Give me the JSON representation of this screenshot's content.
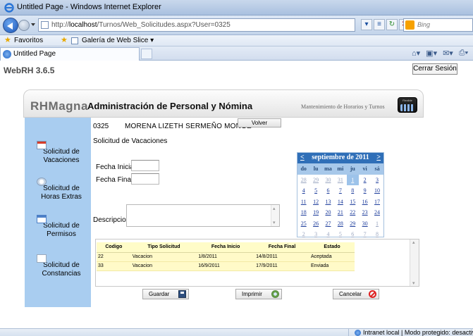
{
  "browser": {
    "window_title": "Untitled Page - Windows Internet Explorer",
    "url_prefix": "http://",
    "url_host": "localhost",
    "url_path": "/Turnos/Web_Solicitudes.aspx?User=0325",
    "search_placeholder": "Bing",
    "favorites_label": "Favoritos",
    "gallery_label": "Galería de Web Slice ▾",
    "tab_title": "Untitled Page",
    "status_text": "Intranet local | Modo protegido: desactivado"
  },
  "page": {
    "version": "WebRH 3.6.5",
    "logout_label": "Cerrar Sesión",
    "brand": "RHMagna",
    "app_title": "Administración de Personal y Nómina",
    "subtitle": "Mantenimiento de Horarios y Turnos",
    "logo_text": "Flexible"
  },
  "sidebar": {
    "items": [
      {
        "label": "Solicitud de Vacaciones",
        "icon": "calendar-icon"
      },
      {
        "label": "Solicitud de Horas Extras",
        "icon": "clock-icon"
      },
      {
        "label": "Solicitud de Permisos",
        "icon": "window-icon"
      },
      {
        "label": "Solicitud de Constancias",
        "icon": "document-icon"
      }
    ]
  },
  "form": {
    "employee_code": "0325",
    "employee_name": "MORENA LIZETH SERMEÑO MONGE",
    "back_label": "Volver",
    "section_title": "Solicitud de Vacaciones",
    "start_date_label": "Fecha Inicial",
    "start_date_value": "",
    "end_date_label": "Fecha Final",
    "end_date_value": "",
    "description_label": "Descripcion",
    "description_value": ""
  },
  "calendar": {
    "prev": "<",
    "next": ">",
    "title": "septiembre de 2011",
    "weekdays": [
      "do",
      "lu",
      "ma",
      "mi",
      "ju",
      "vi",
      "sá"
    ],
    "weeks": [
      [
        {
          "d": "28",
          "o": true
        },
        {
          "d": "29",
          "o": true
        },
        {
          "d": "30",
          "o": true
        },
        {
          "d": "31",
          "o": true
        },
        {
          "d": "1",
          "s": true
        },
        {
          "d": "2"
        },
        {
          "d": "3"
        }
      ],
      [
        {
          "d": "4"
        },
        {
          "d": "5"
        },
        {
          "d": "6"
        },
        {
          "d": "7"
        },
        {
          "d": "8"
        },
        {
          "d": "9"
        },
        {
          "d": "10"
        }
      ],
      [
        {
          "d": "11"
        },
        {
          "d": "12"
        },
        {
          "d": "13"
        },
        {
          "d": "14"
        },
        {
          "d": "15"
        },
        {
          "d": "16"
        },
        {
          "d": "17"
        }
      ],
      [
        {
          "d": "18"
        },
        {
          "d": "19"
        },
        {
          "d": "20"
        },
        {
          "d": "21"
        },
        {
          "d": "22"
        },
        {
          "d": "23"
        },
        {
          "d": "24"
        }
      ],
      [
        {
          "d": "25"
        },
        {
          "d": "26"
        },
        {
          "d": "27"
        },
        {
          "d": "28"
        },
        {
          "d": "29"
        },
        {
          "d": "30"
        },
        {
          "d": "1",
          "o": true
        }
      ],
      [
        {
          "d": "2",
          "o": true
        },
        {
          "d": "3",
          "o": true
        },
        {
          "d": "4",
          "o": true
        },
        {
          "d": "5",
          "o": true
        },
        {
          "d": "6",
          "o": true
        },
        {
          "d": "7",
          "o": true
        },
        {
          "d": "8",
          "o": true
        }
      ]
    ]
  },
  "requests_table": {
    "columns": [
      "Codigo",
      "Tipo Solicitud",
      "Fecha Inicio",
      "Fecha Final",
      "Estado"
    ],
    "rows": [
      [
        "22",
        "Vacacion",
        "1/8/2011",
        "14/8/2011",
        "Aceptada"
      ],
      [
        "33",
        "Vacacion",
        "16/9/2011",
        "17/9/2011",
        "Enviada"
      ]
    ]
  },
  "actions": {
    "save_label": "Guardar",
    "print_label": "Imprimir",
    "cancel_label": "Cancelar"
  },
  "colors": {
    "sidebar": "#a9cdf0",
    "calendar_header": "#2f6fb8",
    "grid_row": "#fffac8"
  }
}
